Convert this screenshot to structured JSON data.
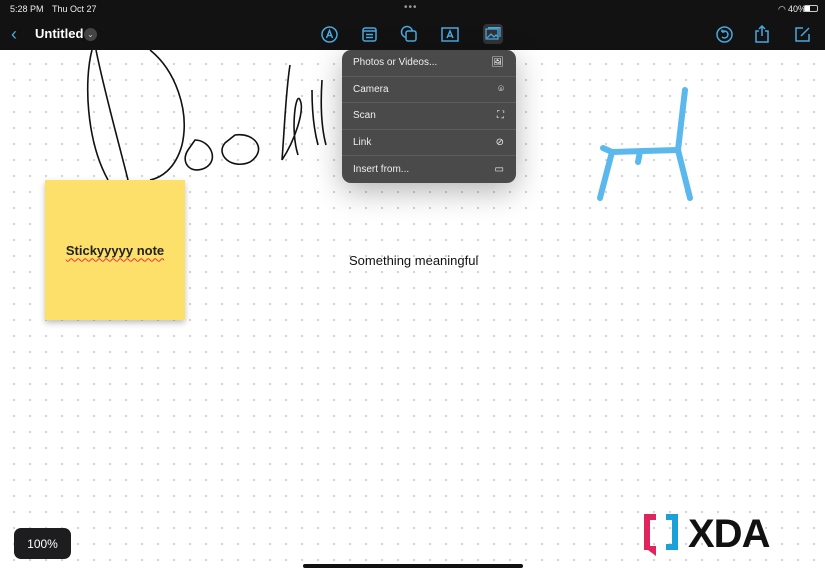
{
  "status": {
    "time": "5:28 PM",
    "date": "Thu Oct 27",
    "battery": "40%"
  },
  "toolbar": {
    "title": "Untitled"
  },
  "menu": {
    "items": [
      {
        "label": "Photos or Videos...",
        "icon": "photo-icon"
      },
      {
        "label": "Camera",
        "icon": "camera-icon"
      },
      {
        "label": "Scan",
        "icon": "scan-icon"
      },
      {
        "label": "Link",
        "icon": "compass-icon"
      },
      {
        "label": "Insert from...",
        "icon": "folder-icon"
      }
    ]
  },
  "canvas": {
    "sticky_note": "Stickyyyyy note",
    "text_box": "Something meaningful"
  },
  "zoom_level": "100%",
  "watermark": "XDA",
  "colors": {
    "accent": "#4aa8e0",
    "sticky": "#fde069",
    "chair": "#5bb8ec"
  }
}
